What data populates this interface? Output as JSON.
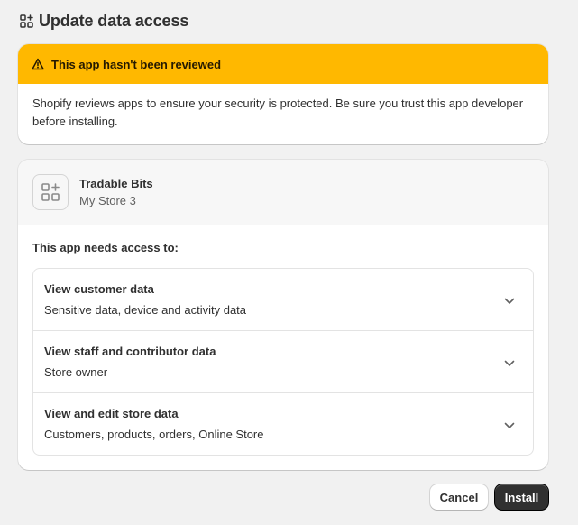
{
  "header": {
    "title": "Update data access",
    "icon": "apps-icon"
  },
  "warning": {
    "title": "This app hasn't been reviewed",
    "body": "Shopify reviews apps to ensure your security is protected. Be sure you trust this app developer before installing.",
    "icon": "alert-triangle-icon",
    "color": "#ffb800"
  },
  "app": {
    "name": "Tradable Bits",
    "store": "My Store 3",
    "logo_icon": "apps-icon"
  },
  "access": {
    "title": "This app needs access to:",
    "items": [
      {
        "title": "View customer data",
        "desc": "Sensitive data, device and activity data"
      },
      {
        "title": "View staff and contributor data",
        "desc": "Store owner"
      },
      {
        "title": "View and edit store data",
        "desc": "Customers, products, orders, Online Store"
      }
    ]
  },
  "actions": {
    "cancel": "Cancel",
    "install": "Install"
  },
  "colors": {
    "background": "#f1f1f1",
    "primary_button": "#303030",
    "warning": "#ffb800"
  }
}
